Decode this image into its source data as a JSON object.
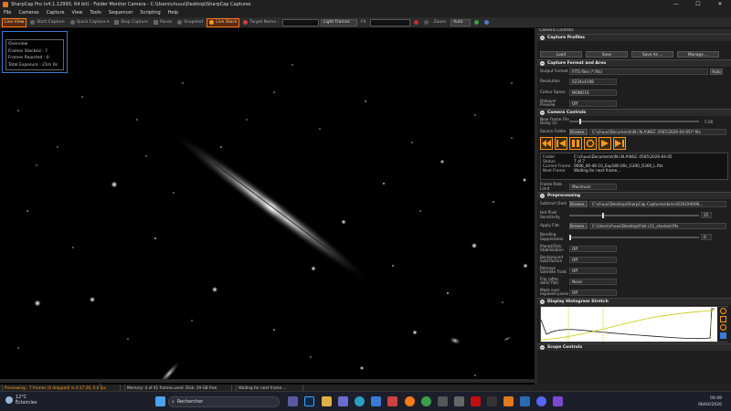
{
  "window": {
    "title": "SharpCap Pro (v4.1.12993, 64 bit) - Folder Monitor Camera - C:\\Users\\chuus\\Desktop\\SharpCap Captures",
    "minimize": "—",
    "maximize": "☐",
    "close": "✕"
  },
  "menu": [
    "File",
    "Cameras",
    "Capture",
    "View",
    "Tools",
    "Sequencer",
    "Scripting",
    "Help"
  ],
  "toolbar": {
    "live_view": "Live View",
    "start_capture": "Start Capture",
    "quick_capture": "Quick Capture",
    "stop_capture": "Stop Capture",
    "pause": "Pause",
    "snapshot": "Snapshot",
    "live_stack": "Live Stack",
    "target_name_label": "Target Name :",
    "target_name_value": "",
    "frame_type": "Light Frames",
    "fx_label": "FX",
    "fx_value": "",
    "zoom_label": "Zoom:",
    "zoom_value": "Auto"
  },
  "overview": {
    "title": "Overview",
    "frames_stacked": "Frames Stacked : 7",
    "frames_rejected": "Frames Rejected : 0",
    "total_exposure": "Total Exposure : 21m 0s"
  },
  "panel": {
    "title": "Camera Controls",
    "capture_profiles": {
      "header": "Capture Profiles",
      "load": "Load",
      "save": "Save",
      "save_as": "Save As ...",
      "manage": "Manage ..."
    },
    "capture_format": {
      "header": "Capture Format and Area",
      "output_format_label": "Output Format",
      "output_format_value": "FITS files (*.fits)",
      "auto": "Auto",
      "resolution_label": "Resolution",
      "resolution_value": "6224x4168",
      "colour_space_label": "Colour Space",
      "colour_space_value": "MONO16",
      "debayer_label": "Debayer Preview",
      "debayer_value": "Off"
    },
    "camera_controls": {
      "header": "Camera Controls",
      "poll_label": "New Frame File Delay (s)",
      "poll_value": "5.00",
      "poll_level": 0.08,
      "source_folder_label": "Source Folder",
      "browse": "Browse...",
      "source_folder_value": "C:\\chuus\\Documents\\N.I.N.A\\NGC 4565\\2026-04-05\\*.fits",
      "folder_label": "Folder:",
      "folder_value": "C:\\chuus\\Documents\\N.I.N.A\\NGC 4565\\2026-04-05",
      "status_label": "Status:",
      "status_value": "7 of 7",
      "current_frame_label": "Current Frame:",
      "current_frame_value": "0006_00-46-16_Exp180.00s_G300_O300_L.fits",
      "next_frame_label": "Next Frame:",
      "next_frame_value": "Waiting for next frame...",
      "frame_rate_label": "Frame Rate Limit",
      "frame_rate_value": "Maximum"
    },
    "preprocessing": {
      "header": "Preprocessing",
      "subtract_dark_label": "Subtract Dark",
      "browse": "Browse...",
      "subtract_dark_value": "C:\\chuus\\Desktop\\SharpCap Captures\\darks\\6192X4096...",
      "hot_pixel_label": "Hot Pixel Sensitivity",
      "hot_pixel_value": "25",
      "hot_pixel_level": 0.25,
      "apply_flat_label": "Apply Flat",
      "apply_flat_value": "C:\\Users\\chuus\\Desktop\\Flat-c11_stacked.fits",
      "banding_label": "Banding Suppression",
      "banding_value": "0",
      "banding_level": 0.0,
      "planet_disk_label": "Planet/Disk Stabilization",
      "planet_disk_value": "Off",
      "background_label": "Background Subtraction",
      "background_value": "Off",
      "satellite_label": "Remove Satellite Trails",
      "satellite_value": "Off",
      "flip_label": "Flip (after dark/ flat)",
      "flip_value": "None",
      "mask_label": "Mask over exposed pixels",
      "mask_value": "Off"
    },
    "histogram": {
      "header": "Display Histogram Stretch"
    },
    "scope": {
      "header": "Scope Controls"
    }
  },
  "statusbar": {
    "previewing": "Previewing : 7 frames (0 dropped) in 0:17:26, 0.0 fps",
    "memory": "Memory: 4 of 41 frames used. Disk: 29 GB free",
    "waiting": "Waiting for next frame...."
  },
  "taskbar": {
    "temp": "12°C",
    "weather": "Éclaircies",
    "search": "Rechercher",
    "time": "00:49",
    "date": "06/04/2026"
  },
  "colors": {
    "accent": "#ff7a1a",
    "overview_border": "#3a7bd5"
  }
}
